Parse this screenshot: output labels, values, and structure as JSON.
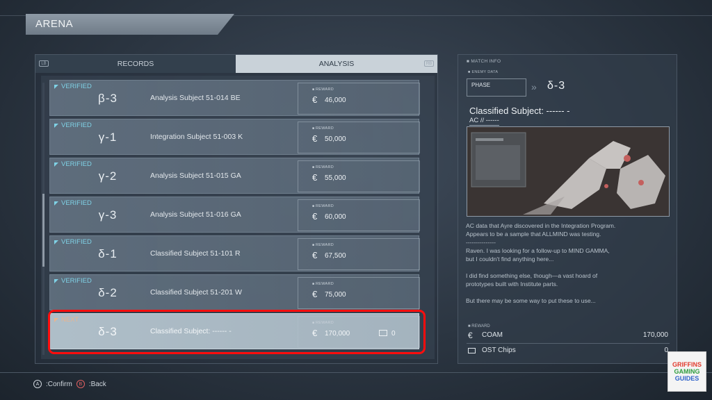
{
  "screen_title": "ARENA",
  "tabs": {
    "left_bumper": "LB",
    "records": "RECORDS",
    "analysis": "ANALYSIS",
    "right_bumper": "RB"
  },
  "reward_label": "REWARD",
  "currency_symbol": "€",
  "rows": [
    {
      "status": "VERIFIED",
      "code": "β-3",
      "name": "Analysis Subject 51-014 BE",
      "reward": "46,000"
    },
    {
      "status": "VERIFIED",
      "code": "γ-1",
      "name": "Integration Subject 51-003 K",
      "reward": "50,000"
    },
    {
      "status": "VERIFIED",
      "code": "γ-2",
      "name": "Analysis Subject 51-015 GA",
      "reward": "55,000"
    },
    {
      "status": "VERIFIED",
      "code": "γ-3",
      "name": "Analysis Subject 51-016 GA",
      "reward": "60,000"
    },
    {
      "status": "VERIFIED",
      "code": "δ-1",
      "name": "Classified Subject 51-101 R",
      "reward": "67,500"
    },
    {
      "status": "VERIFIED",
      "code": "δ-2",
      "name": "Classified Subject 51-201 W",
      "reward": "75,000"
    },
    {
      "status": "NEXT",
      "code": "δ-3",
      "name": "Classified Subject: ------ -",
      "reward": "170,000",
      "chips": "0"
    }
  ],
  "match_info": {
    "header": "MATCH INFO",
    "enemy_data": "ENEMY DATA",
    "phase_label": "PHASE",
    "phase_value": "δ-3",
    "subject_title": "Classified Subject: ------ -",
    "subject_sub": "AC // ------",
    "description": "AC data that Ayre discovered in the Integration Program.\nAppears to be a sample that ALLMIND was testing.\n---------------\nRaven. I was looking for a follow-up to MIND GAMMA,\nbut I couldn't find anything here...\n\nI did find something else, though—a vast hoard of\nprototypes built with Institute parts.\n\nBut there may be some way to put these to use...",
    "reward_label": "REWARD",
    "coam_label": "COAM",
    "coam_value": "170,000",
    "ost_label": "OST Chips",
    "ost_value": "0"
  },
  "footer": {
    "confirm_btn": "A",
    "confirm": ":Confirm",
    "back_btn": "B",
    "back": ":Back"
  },
  "logo": {
    "line1": "GRIFFINS",
    "line2": "GAMING",
    "line3": "GUIDES"
  },
  "colors": {
    "verified": "#7fd2e6",
    "next": "#e9b48f",
    "highlight": "#ff0d0d"
  }
}
